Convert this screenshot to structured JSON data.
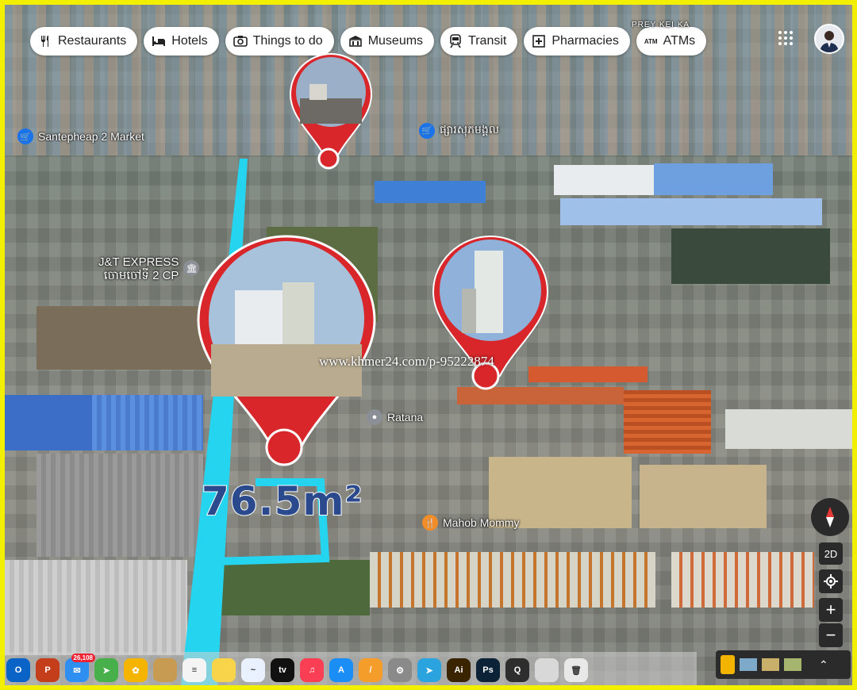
{
  "categories": [
    {
      "label": "Restaurants",
      "icon": "fork-knife-icon"
    },
    {
      "label": "Hotels",
      "icon": "bed-icon"
    },
    {
      "label": "Things to do",
      "icon": "camera-icon"
    },
    {
      "label": "Museums",
      "icon": "museum-icon"
    },
    {
      "label": "Transit",
      "icon": "train-icon"
    },
    {
      "label": "Pharmacies",
      "icon": "pharmacy-icon"
    },
    {
      "label": "ATMs",
      "icon": "atm-icon",
      "icon_text": "ATM"
    }
  ],
  "map": {
    "top_label": "PREY KEI KA",
    "places": [
      {
        "name": "Santepheap 2 Market",
        "icon": "shopping-cart-icon"
      },
      {
        "name": "ផ្សារសុភមង្គល",
        "icon": "shopping-cart-icon"
      },
      {
        "name": "J&T EXPRESS",
        "name2": "ចោមចៅទី 2 CP",
        "icon": "bank-icon"
      },
      {
        "name": "Ratana",
        "icon": "location-icon"
      },
      {
        "name": "Mahob Mommy",
        "icon": "restaurant-icon"
      }
    ],
    "area_label": "76.5m²",
    "watermark": "www.khmer24.com/p-95222874"
  },
  "controls": {
    "view_2d": "2D",
    "zoom_in": "+",
    "zoom_out": "−"
  },
  "dock": {
    "apps": [
      {
        "name": "outlook",
        "label": "O",
        "color": "#0a64c8"
      },
      {
        "name": "powerpoint",
        "label": "P",
        "color": "#c43e1c"
      },
      {
        "name": "mail",
        "label": "✉",
        "color": "#2f8ff0",
        "badge": "26,108"
      },
      {
        "name": "maps",
        "label": "➤",
        "color": "#47b04b"
      },
      {
        "name": "photos",
        "label": "✿",
        "color": "#f4b400"
      },
      {
        "name": "finder-folder",
        "label": "",
        "color": "#c79b52"
      },
      {
        "name": "reminders",
        "label": "≡",
        "color": "#f4f4f4"
      },
      {
        "name": "notes",
        "label": "",
        "color": "#f7d44a"
      },
      {
        "name": "freeform",
        "label": "~",
        "color": "#e9f1ff"
      },
      {
        "name": "apple-tv",
        "label": "tv",
        "color": "#111111"
      },
      {
        "name": "music",
        "label": "♫",
        "color": "#fa3e53"
      },
      {
        "name": "app-store",
        "label": "A",
        "color": "#1b8ef5"
      },
      {
        "name": "pages",
        "label": "/",
        "color": "#f59d2a"
      },
      {
        "name": "system-settings",
        "label": "⚙",
        "color": "#8a8a8a"
      },
      {
        "name": "telegram",
        "label": "➤",
        "color": "#2aa3df"
      },
      {
        "name": "illustrator",
        "label": "Ai",
        "color": "#3a2400"
      },
      {
        "name": "photoshop",
        "label": "Ps",
        "color": "#0b2237"
      },
      {
        "name": "quicktime",
        "label": "Q",
        "color": "#2e2e2e"
      },
      {
        "name": "preview",
        "label": "",
        "color": "#d8d8d8"
      },
      {
        "name": "trash",
        "label": "🗑",
        "color": "#e8e8e8"
      }
    ]
  }
}
